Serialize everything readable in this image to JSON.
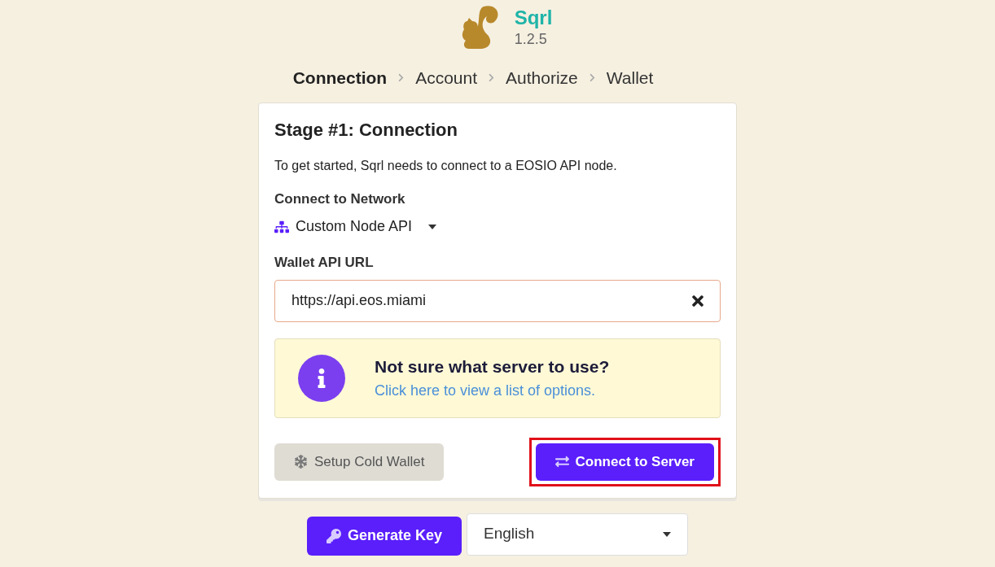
{
  "app": {
    "name": "Sqrl",
    "version": "1.2.5"
  },
  "steps": [
    {
      "label": "Connection",
      "selected": true
    },
    {
      "label": "Account",
      "selected": false
    },
    {
      "label": "Authorize",
      "selected": false
    },
    {
      "label": "Wallet",
      "selected": false
    }
  ],
  "card": {
    "title": "Stage #1: Connection",
    "intro": "To get started, Sqrl needs to connect to a EOSIO API node.",
    "network_label": "Connect to Network",
    "network_value": "Custom Node API",
    "url_label": "Wallet API URL",
    "url_value": "https://api.eos.miami",
    "notice": {
      "title": "Not sure what server to use?",
      "link": "Click here to view a list of options."
    },
    "buttons": [
      {
        "label": "Setup Cold Wallet",
        "kind": "secondary",
        "highlighted": false
      },
      {
        "label": "Connect to Server",
        "kind": "primary",
        "highlighted": true
      }
    ]
  },
  "footer": {
    "button": "Generate Key",
    "language": "English"
  }
}
